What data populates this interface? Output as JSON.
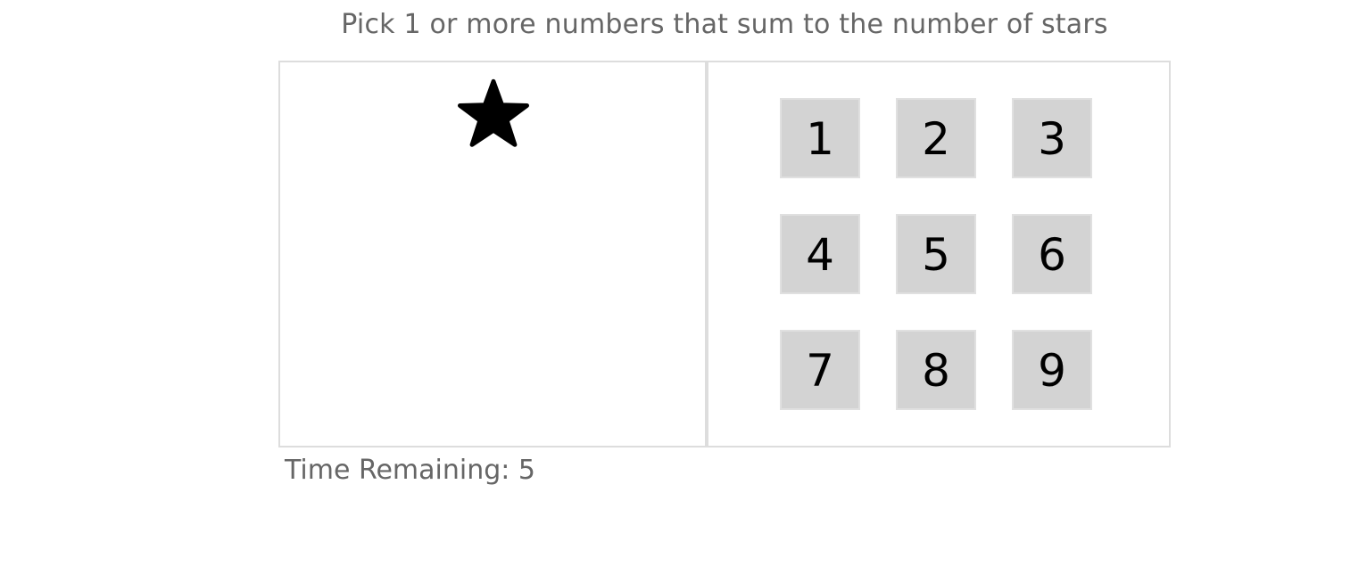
{
  "help_text": "Pick 1 or more numbers that sum to the number of stars",
  "stars": {
    "count": 1,
    "icon": "star-icon",
    "color": "#000000"
  },
  "numbers": [
    "1",
    "2",
    "3",
    "4",
    "5",
    "6",
    "7",
    "8",
    "9"
  ],
  "timer": {
    "label": "Time Remaining: ",
    "value": "5"
  },
  "colors": {
    "number_bg": "#d3d3d3",
    "border": "#dddddd",
    "text_muted": "#666666"
  }
}
